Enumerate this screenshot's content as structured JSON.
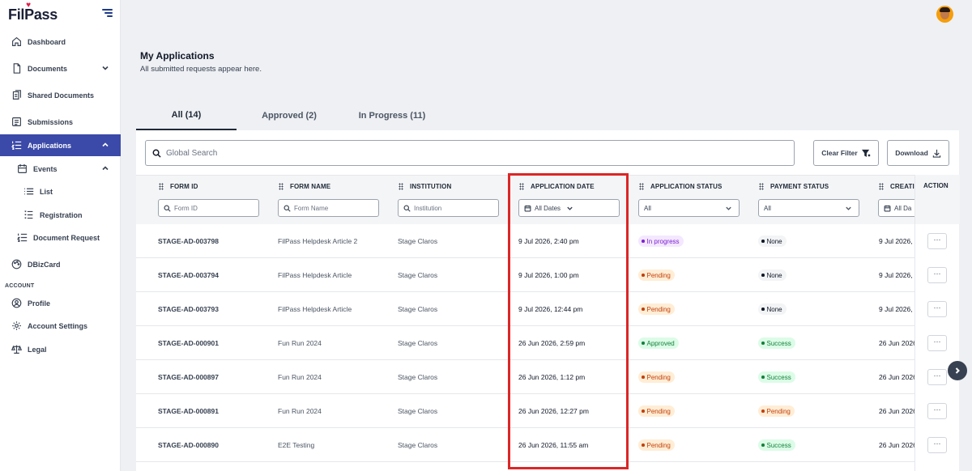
{
  "app": {
    "logo_text_a": "Fil",
    "logo_heart": "♥",
    "logo_text_b": "ass",
    "logo_prefix": "P"
  },
  "sidebar": {
    "items": [
      {
        "label": "Dashboard",
        "icon": "home-icon"
      },
      {
        "label": "Documents",
        "icon": "document-icon"
      },
      {
        "label": "Shared Documents",
        "icon": "shared-documents-icon"
      },
      {
        "label": "Submissions",
        "icon": "submissions-icon"
      },
      {
        "label": "Applications",
        "icon": "list-numbered-icon"
      },
      {
        "label": "Events",
        "icon": "calendar-icon"
      },
      {
        "label": "List",
        "icon": "list-icon"
      },
      {
        "label": "Registration",
        "icon": "registration-icon"
      },
      {
        "label": "Document Request",
        "icon": "list-numbered-icon"
      },
      {
        "label": "DBizCard",
        "icon": "palette-icon"
      },
      {
        "label": "Profile",
        "icon": "user-icon"
      },
      {
        "label": "Account Settings",
        "icon": "gear-icon"
      },
      {
        "label": "Legal",
        "icon": "scale-icon"
      }
    ],
    "section_account": "ACCOUNT"
  },
  "header": {
    "title": "My Applications",
    "subtitle": "All submitted requests appear here."
  },
  "tabs": [
    {
      "label": "All (14)"
    },
    {
      "label": "Approved (2)"
    },
    {
      "label": "In Progress (11)"
    }
  ],
  "toolbar": {
    "search_placeholder": "Global Search",
    "clear_filter": "Clear Filter",
    "download": "Download"
  },
  "table": {
    "columns": [
      {
        "label": "FORM ID",
        "filter": "Form ID"
      },
      {
        "label": "FORM NAME",
        "filter": "Form Name"
      },
      {
        "label": "INSTITUTION",
        "filter": "Institution"
      },
      {
        "label": "APPLICATION DATE",
        "filter": "All Dates"
      },
      {
        "label": "APPLICATION STATUS",
        "filter": "All"
      },
      {
        "label": "PAYMENT STATUS",
        "filter": "All"
      },
      {
        "label": "CREATI",
        "filter": "All Da"
      },
      {
        "label": "ACTION"
      }
    ],
    "rows": [
      {
        "form_id": "STAGE-AD-003798",
        "form_name": "FilPass Helpdesk Article 2",
        "institution": "Stage Claros",
        "date": "9 Jul 2026, 2:40 pm",
        "app_status": "In progress",
        "app_status_type": "progress",
        "pay_status": "None",
        "pay_status_type": "none",
        "created": "9 Jul 2026,",
        "action": "···"
      },
      {
        "form_id": "STAGE-AD-003794",
        "form_name": "FilPass Helpdesk Article",
        "institution": "Stage Claros",
        "date": "9 Jul 2026, 1:00 pm",
        "app_status": "Pending",
        "app_status_type": "pending",
        "pay_status": "None",
        "pay_status_type": "none",
        "created": "9 Jul 2026,",
        "action": "···"
      },
      {
        "form_id": "STAGE-AD-003793",
        "form_name": "FilPass Helpdesk Article",
        "institution": "Stage Claros",
        "date": "9 Jul 2026, 12:44 pm",
        "app_status": "Pending",
        "app_status_type": "pending",
        "pay_status": "None",
        "pay_status_type": "none",
        "created": "9 Jul 2026,",
        "action": "···"
      },
      {
        "form_id": "STAGE-AD-000901",
        "form_name": "Fun Run 2024",
        "institution": "Stage Claros",
        "date": "26 Jun 2026, 2:59 pm",
        "app_status": "Approved",
        "app_status_type": "approved",
        "pay_status": "Success",
        "pay_status_type": "approved",
        "created": "26 Jun 2026",
        "action": "···"
      },
      {
        "form_id": "STAGE-AD-000897",
        "form_name": "Fun Run 2024",
        "institution": "Stage Claros",
        "date": "26 Jun 2026, 1:12 pm",
        "app_status": "Pending",
        "app_status_type": "pending",
        "pay_status": "Success",
        "pay_status_type": "approved",
        "created": "26 Jun 2026",
        "action": "···"
      },
      {
        "form_id": "STAGE-AD-000891",
        "form_name": "Fun Run 2024",
        "institution": "Stage Claros",
        "date": "26 Jun 2026, 12:27 pm",
        "app_status": "Pending",
        "app_status_type": "pending",
        "pay_status": "Pending",
        "pay_status_type": "pending",
        "created": "26 Jun 2026",
        "action": "···"
      },
      {
        "form_id": "STAGE-AD-000890",
        "form_name": "E2E Testing",
        "institution": "Stage Claros",
        "date": "26 Jun 2026, 11:55 am",
        "app_status": "Pending",
        "app_status_type": "pending",
        "pay_status": "Success",
        "pay_status_type": "approved",
        "created": "26 Jun 2026",
        "action": "···"
      }
    ]
  },
  "colors": {
    "accent": "#3b4aa8",
    "highlight": "#dc2626"
  }
}
